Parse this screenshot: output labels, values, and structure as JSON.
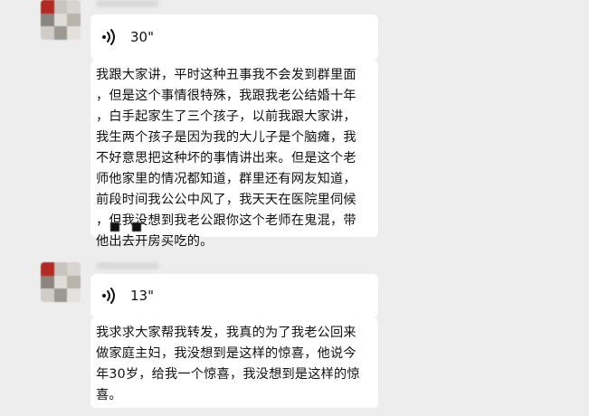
{
  "messages": [
    {
      "voice": {
        "icon": "voice-wave-icon",
        "duration": "30\""
      },
      "text": "我跟大家讲，平时这种丑事我不会发到群里面\n，但是这个事情很特殊，我跟我老公结婚十年\n，白手起家生了三个孩子，以前我跟大家讲，\n我生两个孩子是因为我的大儿子是个脑瘫，我\n不好意思把这种坏的事情讲出来。但是这个老\n师他家里的情况都知道，群里还有网友知道，\n前段时间我公公中风了，我天天在医院里伺候\n，但我没想到我老公跟你这个老师在鬼混，带\n他出去开房买吃的。"
    },
    {
      "voice": {
        "icon": "voice-wave-icon",
        "duration": "13\""
      },
      "text": "我求求大家帮我转发，我真的为了我老公回来\n做家庭主妇，我没想到是这样的惊喜，他说今\n年30岁，给我一个惊喜，我没想到是这样的惊\n喜。"
    }
  ],
  "colors": {
    "background": "#ededed",
    "bubble": "#ffffff"
  }
}
